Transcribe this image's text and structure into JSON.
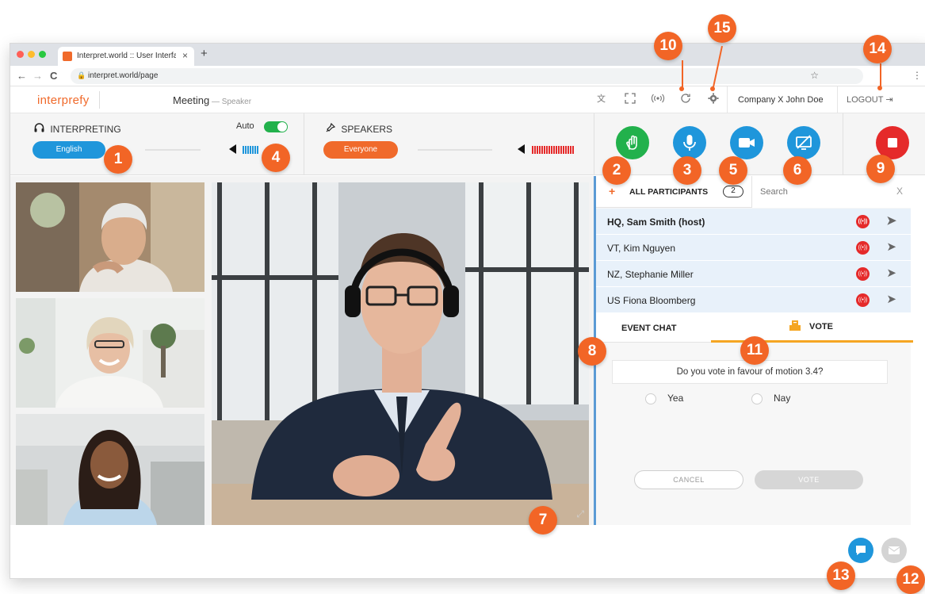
{
  "browser": {
    "tab_title": "Interpret.world :: User Interfac",
    "tab_close": "×",
    "new_tab": "+",
    "url": "interpret.world/page",
    "back": "←",
    "forward": "→",
    "reload": "C",
    "star": "☆",
    "menu": "⋮"
  },
  "header": {
    "logo": "interprefy",
    "meeting": "Meeting",
    "role": " — Speaker",
    "user": "Company X John Doe",
    "logout": "LOGOUT"
  },
  "controls": {
    "interpreting_label": "INTERPRETING",
    "language": "English",
    "auto_label": "Auto",
    "auto_on": true,
    "speakers_label": "SPEAKERS",
    "speakers_value": "Everyone"
  },
  "colors": {
    "accent": "#f06a2b",
    "blue": "#1f96db",
    "green": "#22b14c",
    "red": "#e52a2a",
    "callout": "#f26526"
  },
  "action_buttons": [
    {
      "name": "raise-hand",
      "icon": "hand-icon",
      "color": "#22b14c"
    },
    {
      "name": "microphone",
      "icon": "microphone-icon",
      "color": "#1f96db"
    },
    {
      "name": "camera",
      "icon": "video-camera-icon",
      "color": "#1f96db"
    },
    {
      "name": "screen-share",
      "icon": "screen-share-icon",
      "color": "#1f96db"
    },
    {
      "name": "leave",
      "icon": "stop-icon",
      "color": "#e52a2a"
    }
  ],
  "participants": {
    "header": "ALL PARTICIPANTS",
    "count": "2",
    "search_placeholder": "Search",
    "close": "X",
    "list": [
      {
        "name": "HQ, Sam Smith (host)"
      },
      {
        "name": "VT, Kim Nguyen"
      },
      {
        "name": "NZ, Stephanie Miller"
      },
      {
        "name": "US Fiona Bloomberg"
      }
    ]
  },
  "tabs": {
    "chat": "EVENT CHAT",
    "vote": "VOTE"
  },
  "vote": {
    "question": "Do you vote in favour of motion 3.4?",
    "option_yes": "Yea",
    "option_no": "Nay",
    "cancel": "CANCEL",
    "submit": "VOTE"
  },
  "callouts": [
    "1",
    "2",
    "3",
    "4",
    "5",
    "6",
    "7",
    "8",
    "9",
    "10",
    "11",
    "12",
    "13",
    "14",
    "15"
  ]
}
